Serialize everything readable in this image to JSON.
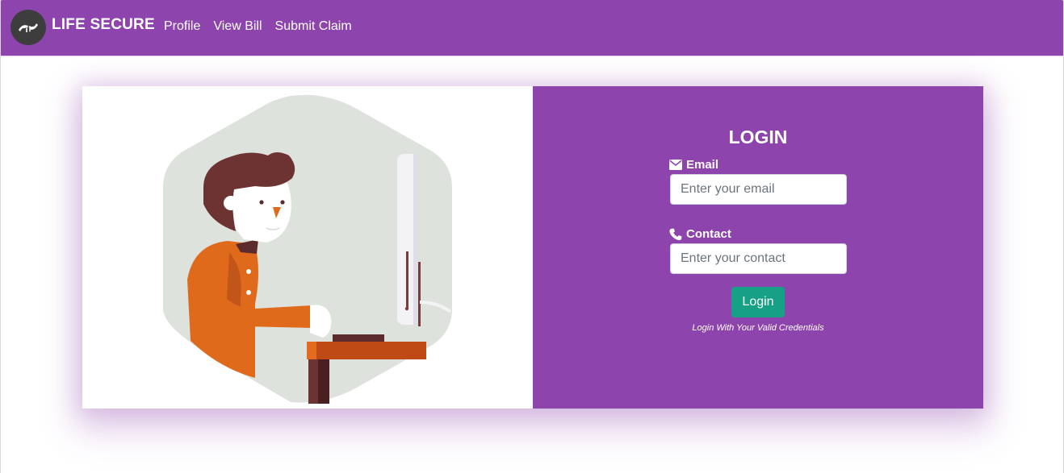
{
  "navbar": {
    "brand": "LIFE SECURE",
    "links": [
      "Profile",
      "View Bill",
      "Submit Claim"
    ],
    "logo_icon": "hands-family-icon",
    "bg_color": "#8e44ad"
  },
  "illustration": {
    "icon": "man-at-computer-illustration"
  },
  "login": {
    "title": "LOGIN",
    "email_label": "Email",
    "email_icon": "envelope-icon",
    "email_placeholder": "Enter your email",
    "contact_label": "Contact",
    "contact_icon": "phone-icon",
    "contact_placeholder": "Enter your contact",
    "button_label": "Login",
    "button_color": "#16a085",
    "hint": "Login With Your Valid Credentials"
  }
}
